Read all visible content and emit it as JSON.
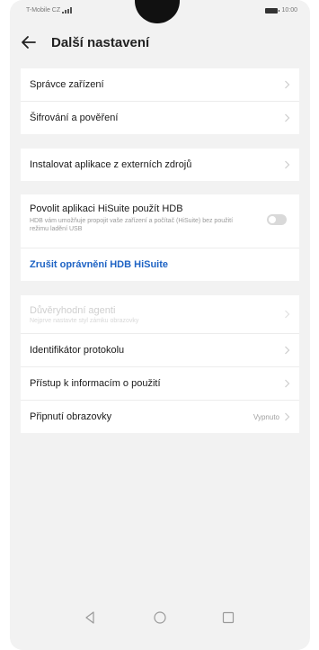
{
  "status_bar": {
    "carrier": "T-Mobile CZ",
    "time": "10:00"
  },
  "header": {
    "title": "Další nastavení"
  },
  "group1": [
    {
      "label": "Správce zařízení"
    },
    {
      "label": "Šifrování a pověření"
    }
  ],
  "group2": [
    {
      "label": "Instalovat aplikace z externích zdrojů"
    }
  ],
  "group3": {
    "hdb": {
      "title": "Povolit aplikaci HiSuite použít HDB",
      "description": "HDB vám umožňuje propojit vaše zařízení a počítač (HiSuite) bez použití režimu ladění USB",
      "enabled": false
    },
    "revoke": {
      "label": "Zrušit oprávnění HDB HiSuite"
    }
  },
  "group4": {
    "agents": {
      "title": "Důvěryhodní agenti",
      "description": "Nejprve nastavte styl zámku obrazovky"
    },
    "items": [
      {
        "label": "Identifikátor protokolu"
      },
      {
        "label": "Přístup k informacím o použití"
      }
    ],
    "pinning": {
      "label": "Připnutí obrazovky",
      "value": "Vypnuto"
    }
  },
  "colors": {
    "accent": "#1e63c4",
    "background": "#f2f2f2"
  }
}
